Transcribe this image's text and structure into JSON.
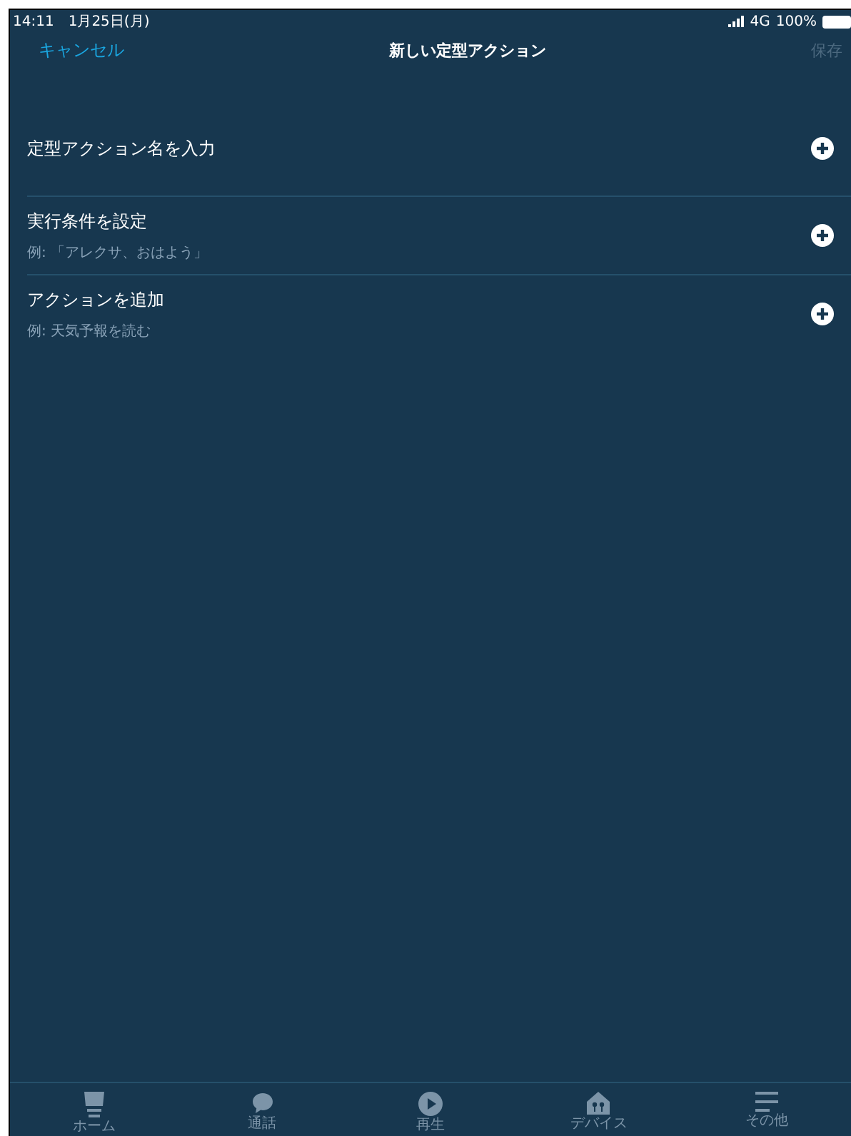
{
  "status_bar": {
    "time": "14:11",
    "date": "1月25日(月)",
    "network": "4G",
    "battery": "100%"
  },
  "nav": {
    "cancel": "キャンセル",
    "title": "新しい定型アクション",
    "save": "保存",
    "save_disabled": true
  },
  "rows": [
    {
      "title": "定型アクション名を入力"
    },
    {
      "title": "実行条件を設定",
      "hint": "例: 「アレクサ、おはよう」"
    },
    {
      "title": "アクションを追加",
      "hint": "例: 天気予報を読む"
    }
  ],
  "tabs": [
    {
      "kind": "home",
      "label": "ホーム"
    },
    {
      "kind": "chat",
      "label": "通話"
    },
    {
      "kind": "play",
      "label": "再生"
    },
    {
      "kind": "devices",
      "label": "デバイス"
    },
    {
      "kind": "more",
      "label": "その他"
    }
  ]
}
